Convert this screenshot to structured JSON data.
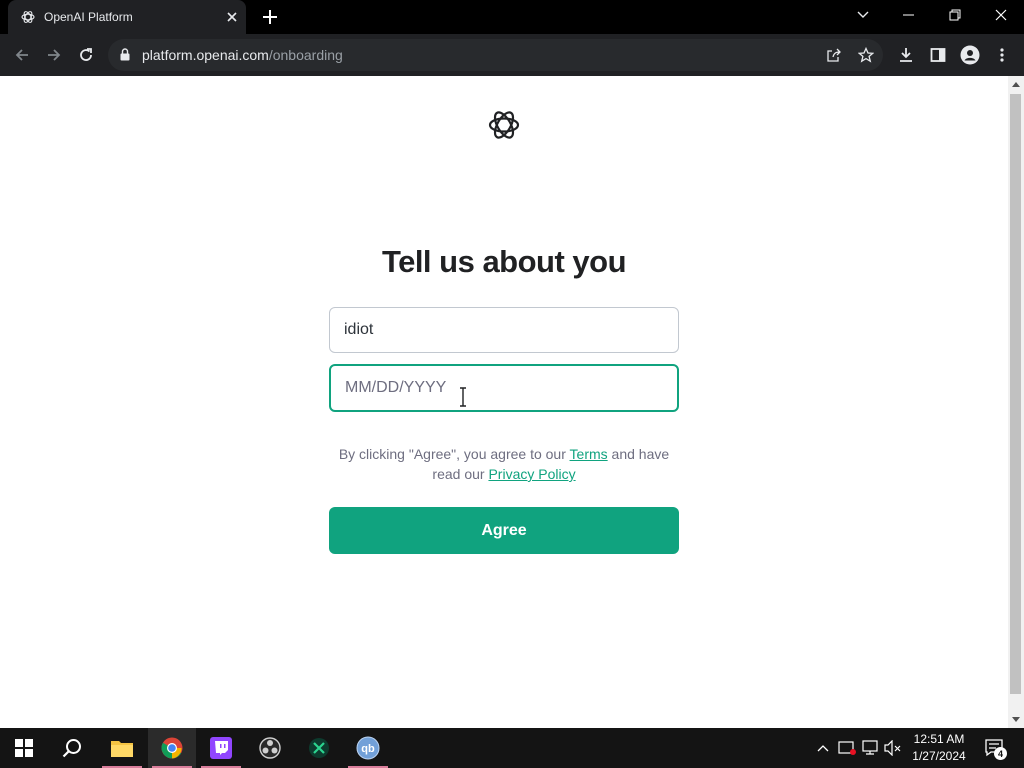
{
  "browser": {
    "tab_title": "OpenAI Platform",
    "url_host": "platform.openai.com",
    "url_path": "/onboarding"
  },
  "page": {
    "heading": "Tell us about you",
    "name_value": "idiot",
    "dob_placeholder": "MM/DD/YYYY",
    "legal_prefix": "By clicking \"Agree\", you agree to our ",
    "terms_link": "Terms",
    "legal_middle": " and have read our ",
    "privacy_link": "Privacy Policy",
    "agree_label": "Agree",
    "accent_color": "#10a37f"
  },
  "taskbar": {
    "apps": [
      "start-icon",
      "search-icon",
      "file-explorer-icon",
      "chrome-icon",
      "twitch-icon",
      "obs-icon",
      "app-icon",
      "qbittorrent-icon"
    ],
    "clock_time": "12:51 AM",
    "clock_date": "1/27/2024",
    "notification_count": "4"
  }
}
